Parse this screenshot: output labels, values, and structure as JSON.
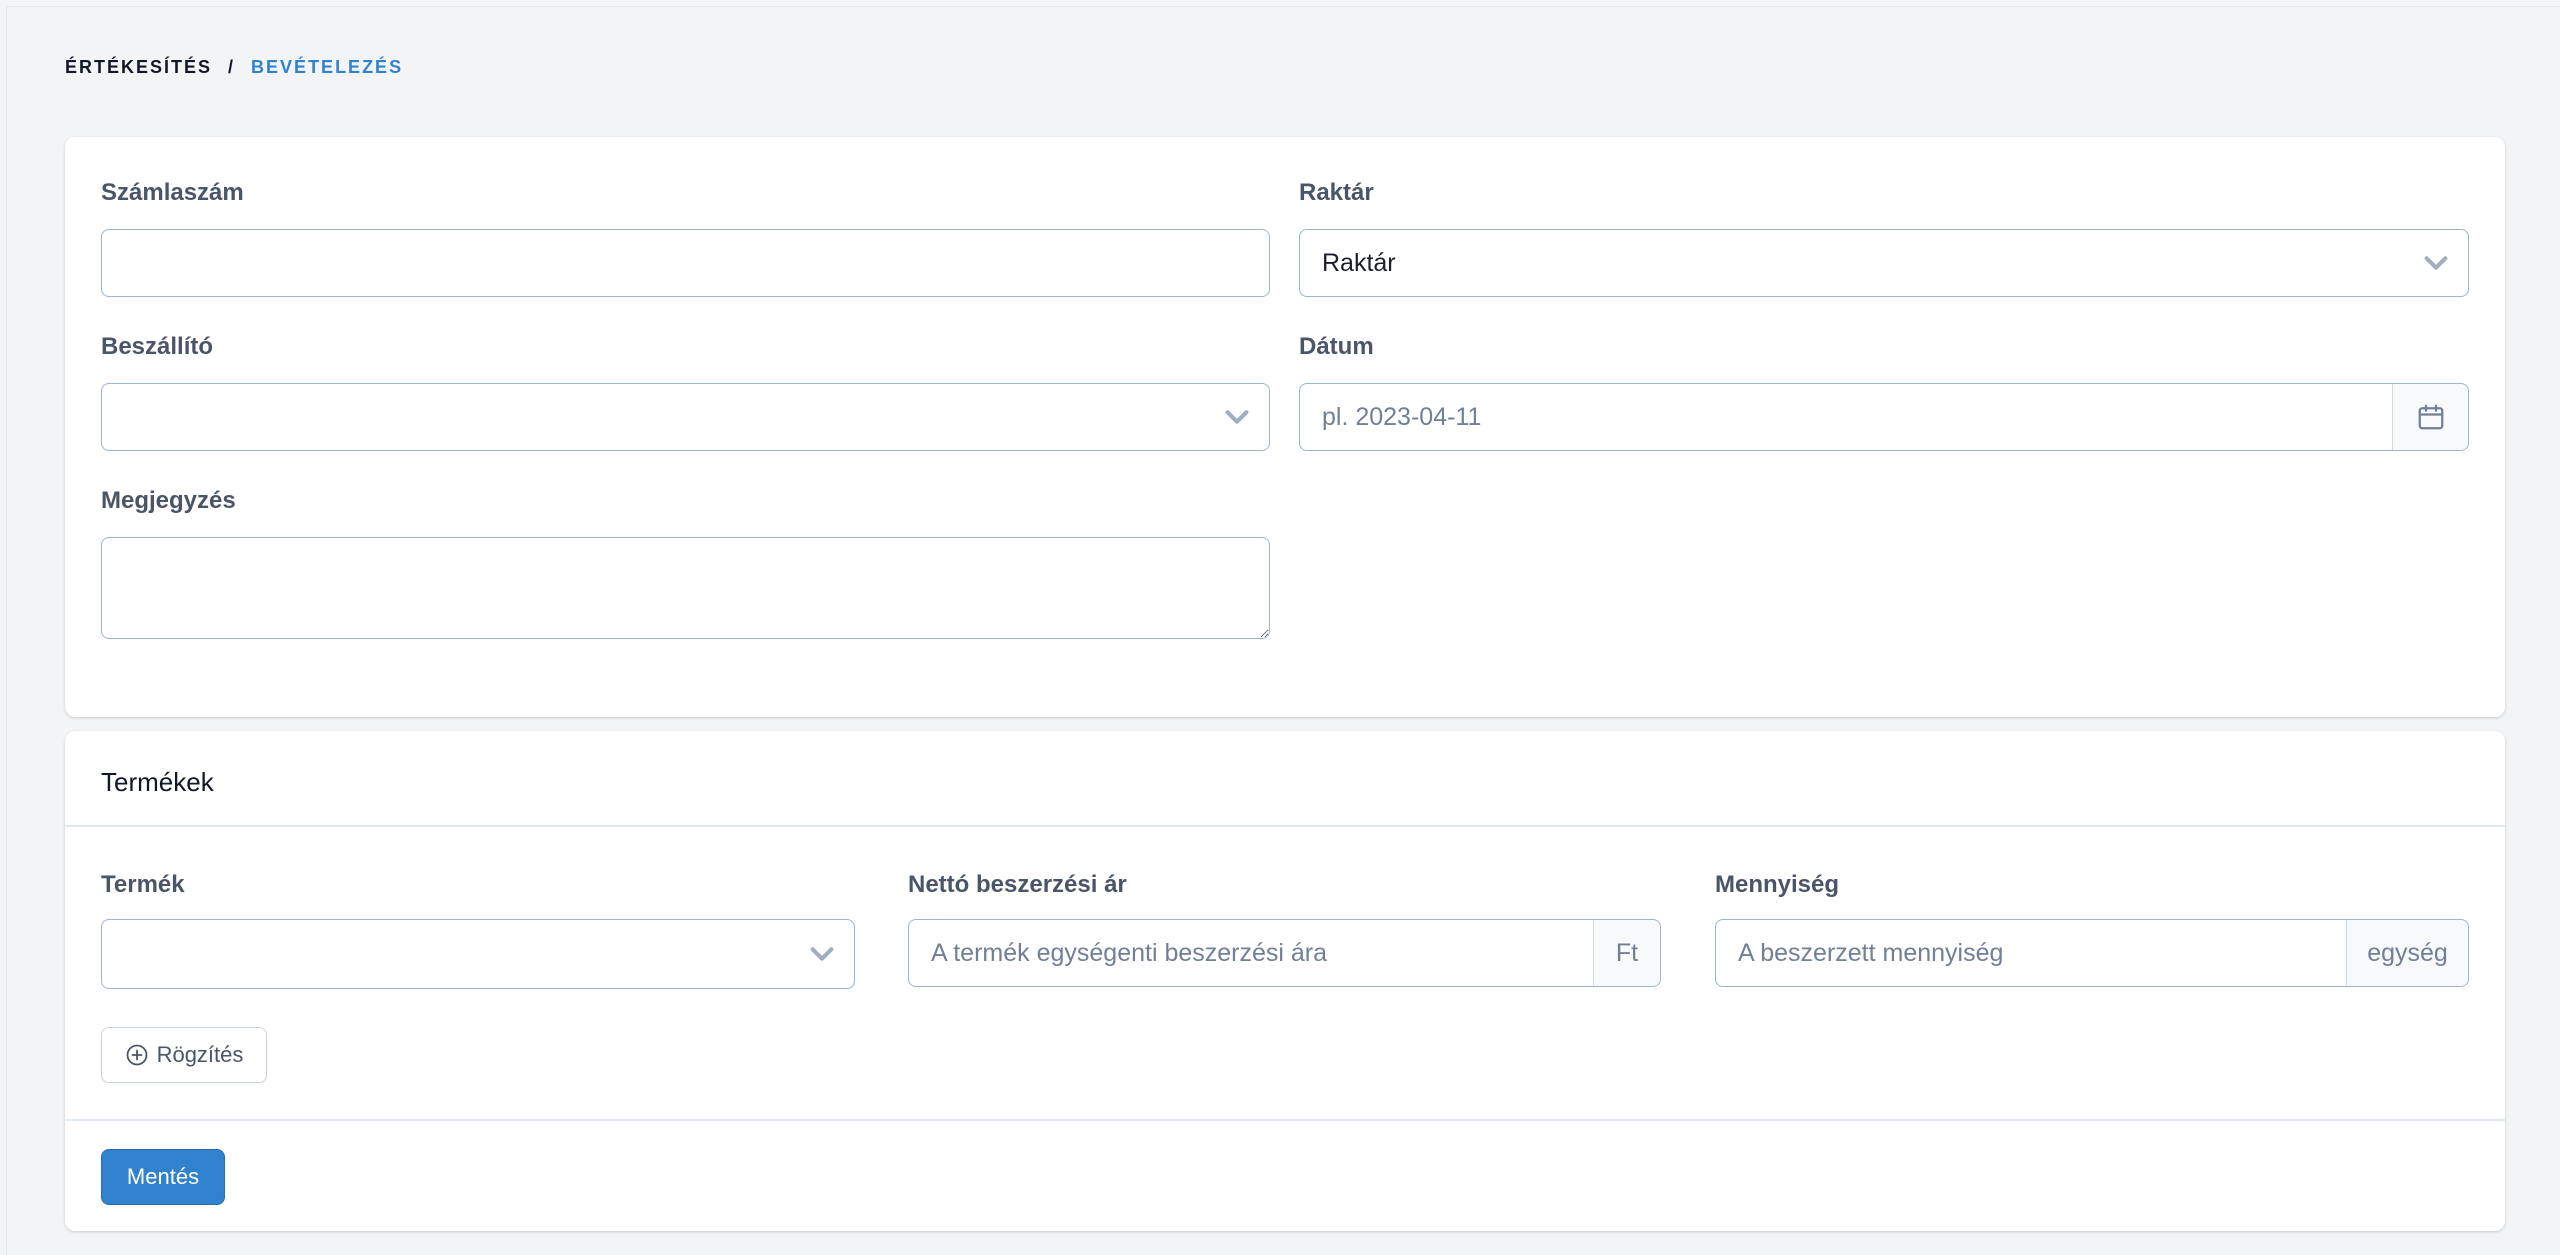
{
  "breadcrumb": {
    "root": "ÉRTÉKESÍTÉS",
    "separator": "/",
    "current": "BEVÉTELEZÉS"
  },
  "form": {
    "invoice": {
      "label": "Számlaszám",
      "value": ""
    },
    "warehouse": {
      "label": "Raktár",
      "value": "Raktár"
    },
    "supplier": {
      "label": "Beszállító",
      "value": ""
    },
    "date": {
      "label": "Dátum",
      "placeholder": "pl. 2023-04-11"
    },
    "note": {
      "label": "Megjegyzés",
      "value": ""
    }
  },
  "products": {
    "title": "Termékek",
    "product": {
      "label": "Termék",
      "value": ""
    },
    "net_price": {
      "label": "Nettó beszerzési ár",
      "placeholder": "A termék egységenti beszerzési ára",
      "unit": "Ft"
    },
    "quantity": {
      "label": "Mennyiség",
      "placeholder": "A beszerzett mennyiség",
      "unit": "egység"
    },
    "record_button": "Rögzítés",
    "save_button": "Mentés"
  },
  "colors": {
    "accent": "#3182ce",
    "background": "#f3f4f6",
    "card": "#ffffff",
    "border": "#a0b4cc"
  },
  "icons": {
    "select": "chevron-down-icon",
    "date": "calendar-icon",
    "record": "plus-circle-icon"
  }
}
